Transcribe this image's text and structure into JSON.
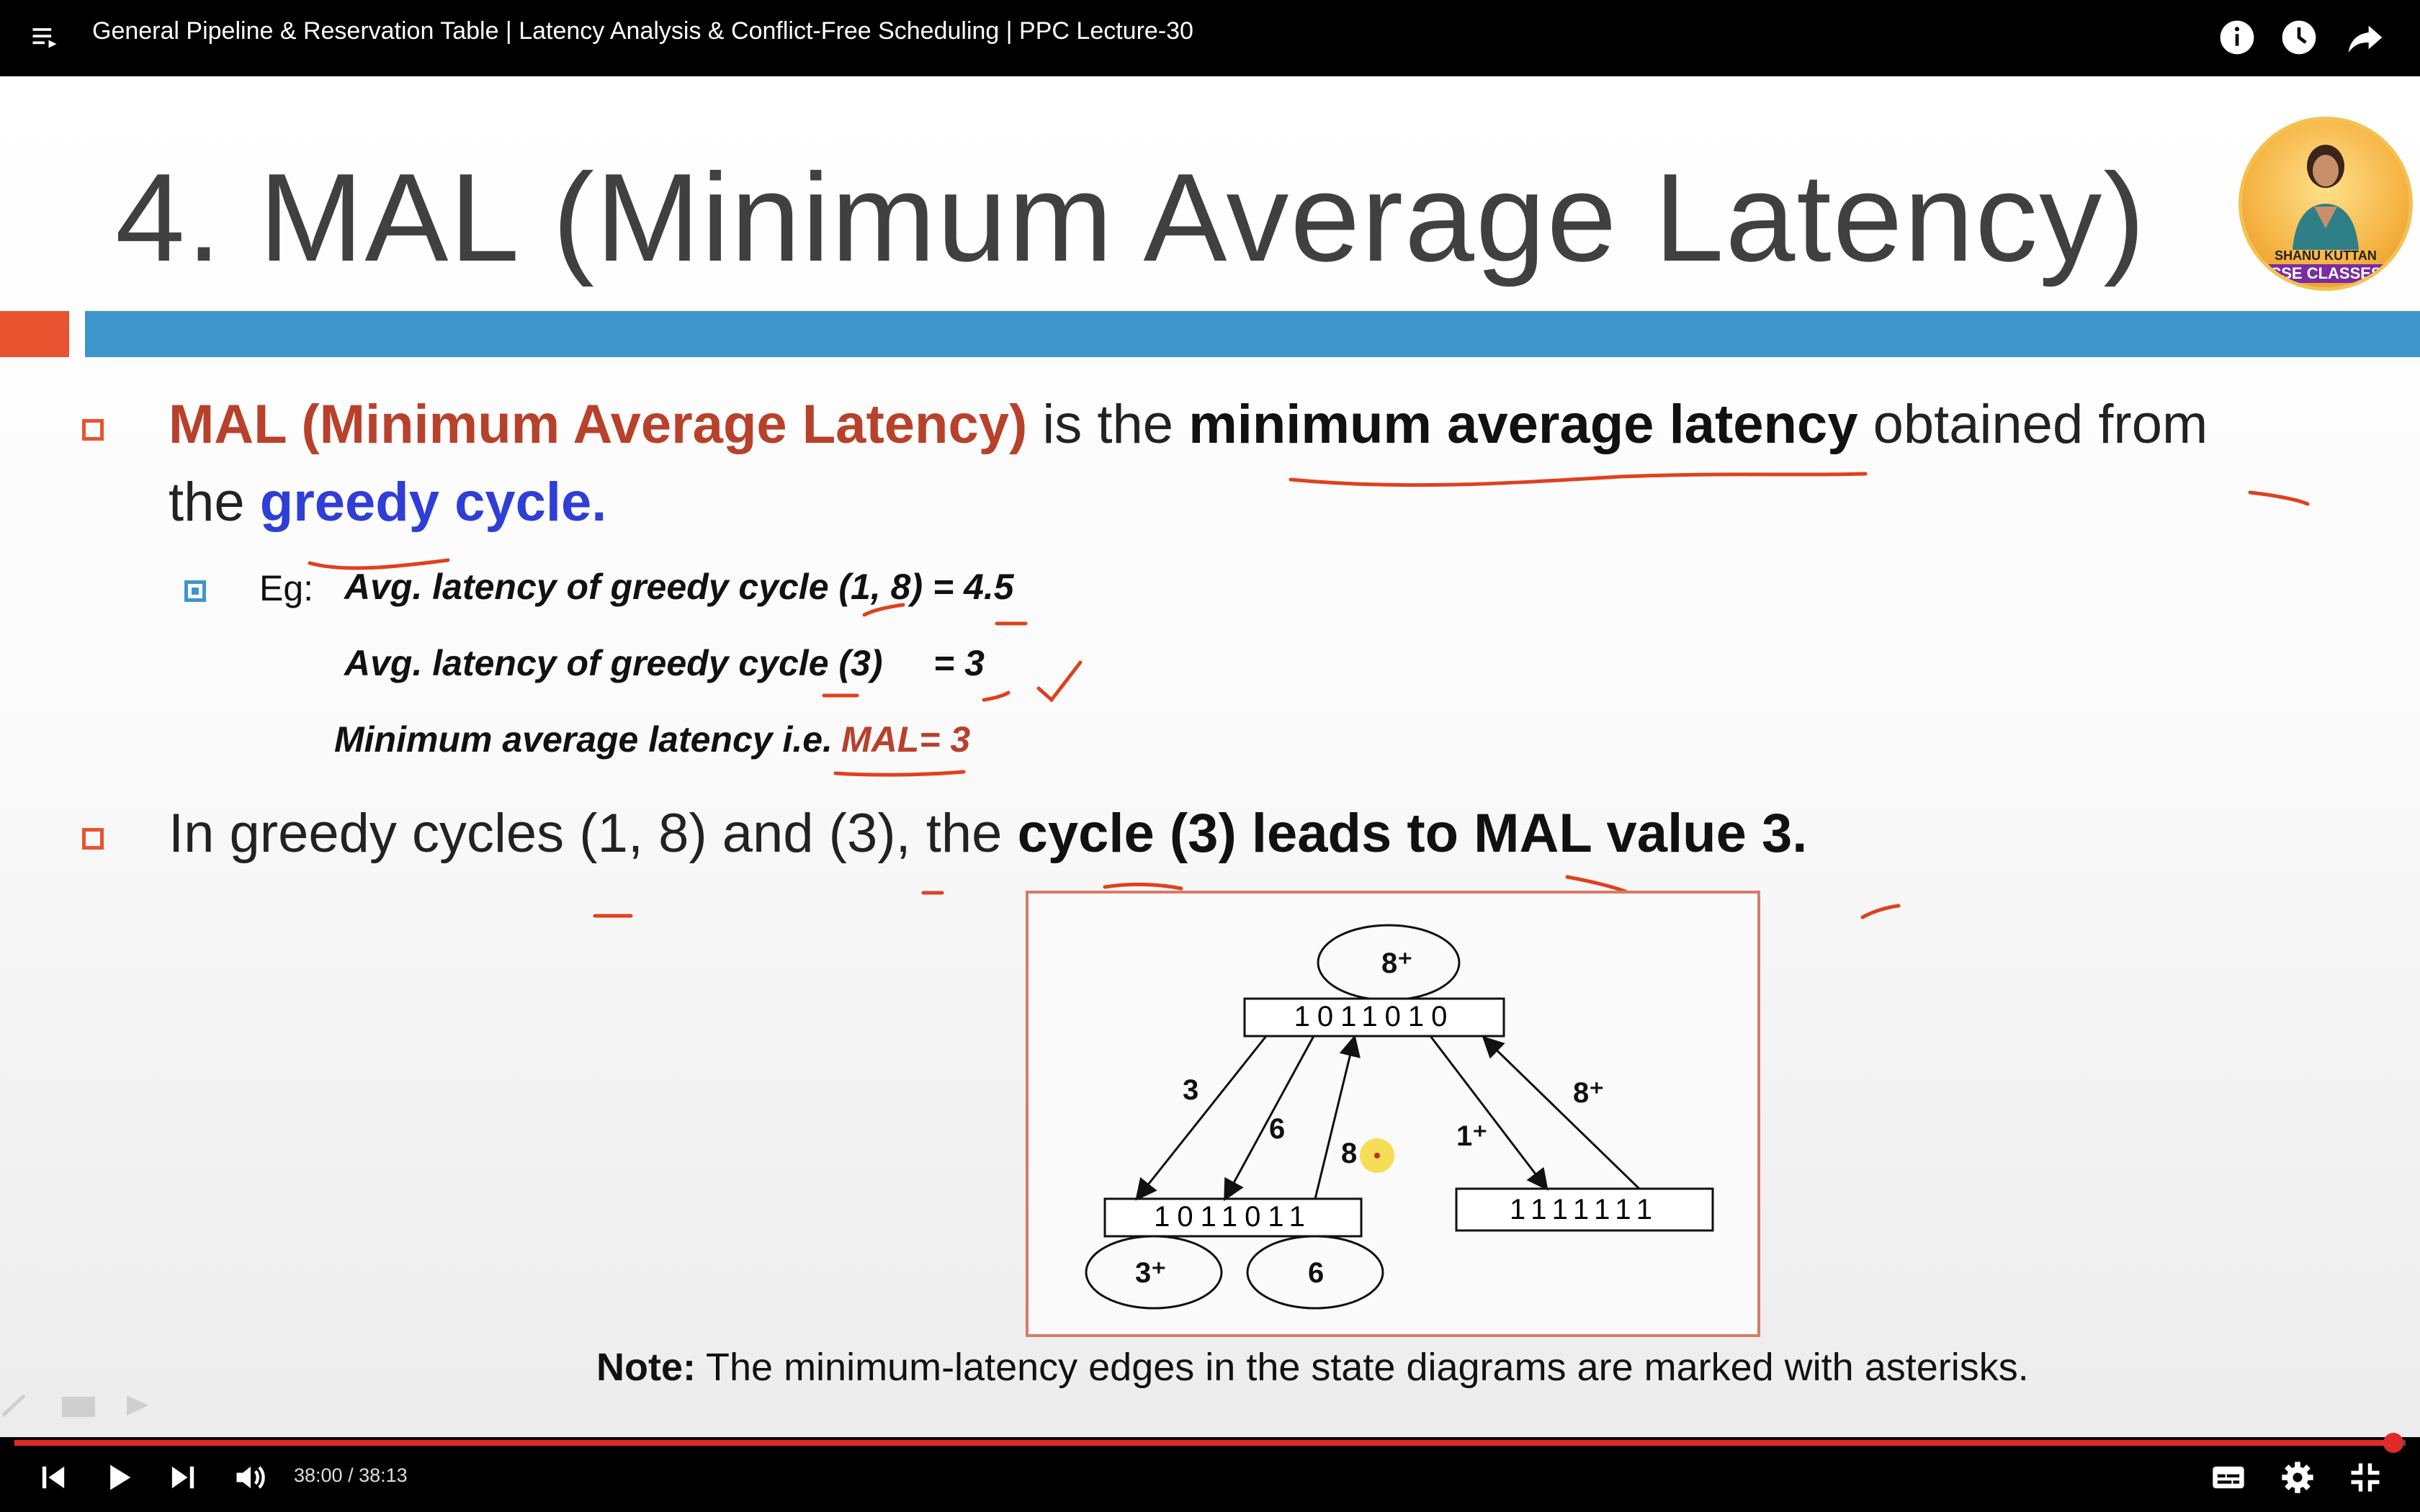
{
  "header": {
    "video_title": "General Pipeline & Reservation Table | Latency Analysis & Conflict-Free Scheduling | PPC Lecture-30",
    "icons": [
      "playlist-icon",
      "info-icon",
      "watch-later-icon",
      "share-icon"
    ]
  },
  "slide": {
    "title": "4. MAL (Minimum Average Latency)",
    "bullet1": {
      "red_part": "MAL (Minimum Average Latency)",
      "text_a": " is the ",
      "bold_part": "minimum average latency",
      "text_b": " obtained from",
      "line2_a": "the ",
      "blue_part": "greedy cycle."
    },
    "example": {
      "prefix": "Eg:",
      "row1": "Avg. latency of greedy cycle (1, 8) = 4.5",
      "row2_a": "Avg. latency of greedy cycle (3)",
      "row2_b": "= 3",
      "row3_a": "Minimum average latency i.e.",
      "row3_b": "MAL= 3"
    },
    "bullet2": {
      "text_a": "In greedy cycles (1, 8) and (3), the ",
      "bold_part": "cycle (3) leads to MAL value 3."
    },
    "note_label": "Note:",
    "note_text": " The minimum-latency edges in the state diagrams are marked with asterisks."
  },
  "diagram": {
    "states": [
      "1011010",
      "1011011",
      "1111111"
    ],
    "edge_labels": [
      "8⁺",
      "3",
      "6",
      "8",
      "1⁺",
      "8⁺",
      "3⁺",
      "6"
    ]
  },
  "avatar": {
    "name": "SHANU KUTTAN",
    "brand": "CSE CLASSES"
  },
  "player": {
    "time": "38:00 / 38:13",
    "progress": 0.995,
    "icons": [
      "previous-icon",
      "play-icon",
      "next-icon",
      "volume-icon",
      "subtitles-icon",
      "settings-icon",
      "exit-fullscreen-icon"
    ]
  },
  "colors": {
    "accent_red": "#e8542f",
    "accent_blue": "#3e95cc",
    "progress_red": "#e02a2a"
  }
}
